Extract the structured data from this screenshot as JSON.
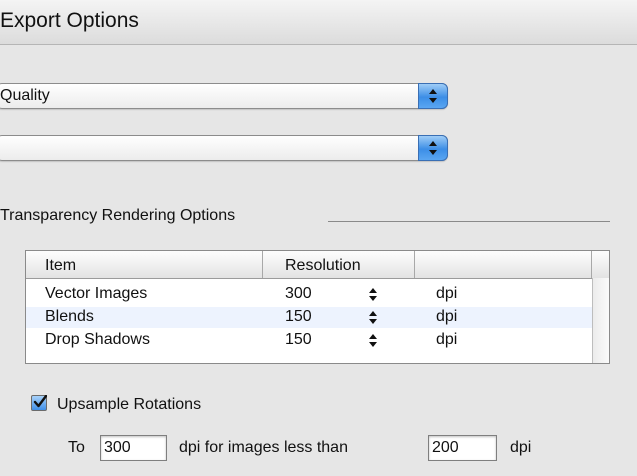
{
  "dialog": {
    "title": "Export Options"
  },
  "popups": [
    {
      "value": "Quality"
    },
    {
      "value": ""
    }
  ],
  "transparency": {
    "group_label": "Transparency Rendering Options",
    "columns": [
      "Item",
      "Resolution",
      ""
    ],
    "rows": [
      {
        "item": "Vector Images",
        "resolution": "300",
        "unit": "dpi"
      },
      {
        "item": "Blends",
        "resolution": "150",
        "unit": "dpi"
      },
      {
        "item": "Drop Shadows",
        "resolution": "150",
        "unit": "dpi"
      }
    ]
  },
  "upsample": {
    "checked": true,
    "label": "Upsample Rotations",
    "to_label": "To",
    "to_value": "300",
    "middle_label": "dpi for images less than",
    "threshold_value": "200",
    "unit_label": "dpi"
  }
}
